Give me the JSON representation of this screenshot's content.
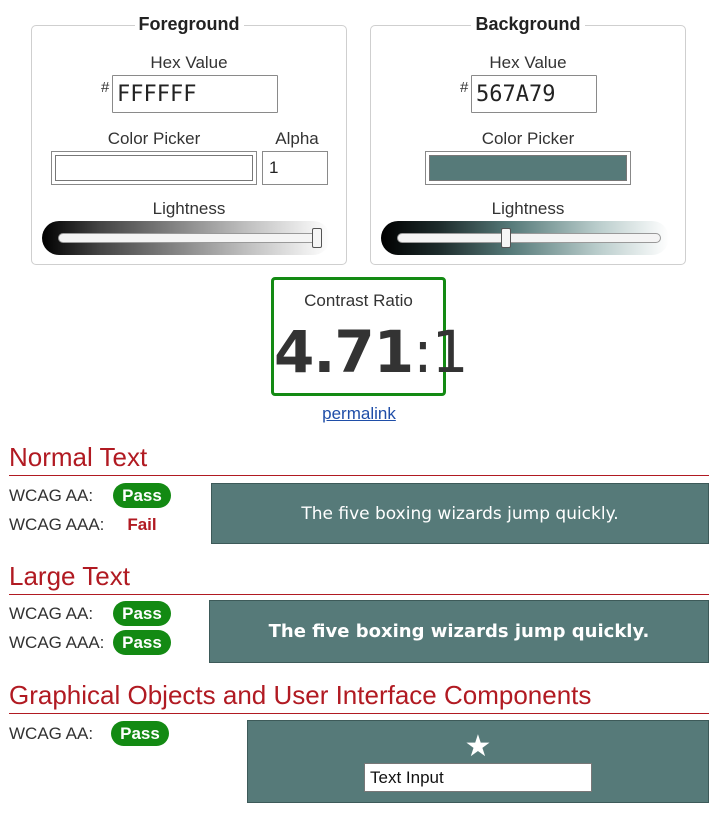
{
  "foreground": {
    "legend": "Foreground",
    "hex_label": "Hex Value",
    "hash": "#",
    "hex_value": "FFFFFF",
    "picker_label": "Color Picker",
    "alpha_label": "Alpha",
    "alpha_value": "1",
    "lightness_label": "Lightness",
    "lightness_level": 1.0,
    "swatch_color": "#FFFFFF"
  },
  "background": {
    "legend": "Background",
    "hex_label": "Hex Value",
    "hash": "#",
    "hex_value": "567A79",
    "picker_label": "Color Picker",
    "lightness_label": "Lightness",
    "lightness_level": 0.41,
    "swatch_color": "#567A79"
  },
  "contrast": {
    "caption": "Contrast Ratio",
    "ratio": "4.71",
    "separator": ":",
    "one": "1",
    "border_color": "#138A13"
  },
  "permalink": "permalink",
  "normal_text": {
    "title": "Normal Text",
    "aa_label": "WCAG AA:",
    "aa_result": "Pass",
    "aaa_label": "WCAG AAA:",
    "aaa_result": "Fail",
    "sample": "The five boxing wizards jump quickly."
  },
  "large_text": {
    "title": "Large Text",
    "aa_label": "WCAG AA:",
    "aa_result": "Pass",
    "aaa_label": "WCAG AAA:",
    "aaa_result": "Pass",
    "sample": "The five boxing wizards jump quickly."
  },
  "graphical": {
    "title": "Graphical Objects and User Interface Components",
    "aa_label": "WCAG AA:",
    "aa_result": "Pass",
    "icon": "star-icon",
    "input_value": "Text Input"
  },
  "colors": {
    "pass": "#138A13",
    "fail": "#B11A22",
    "heading": "#B11A22",
    "sample_bg": "#567A79",
    "sample_fg": "#FFFFFF"
  }
}
